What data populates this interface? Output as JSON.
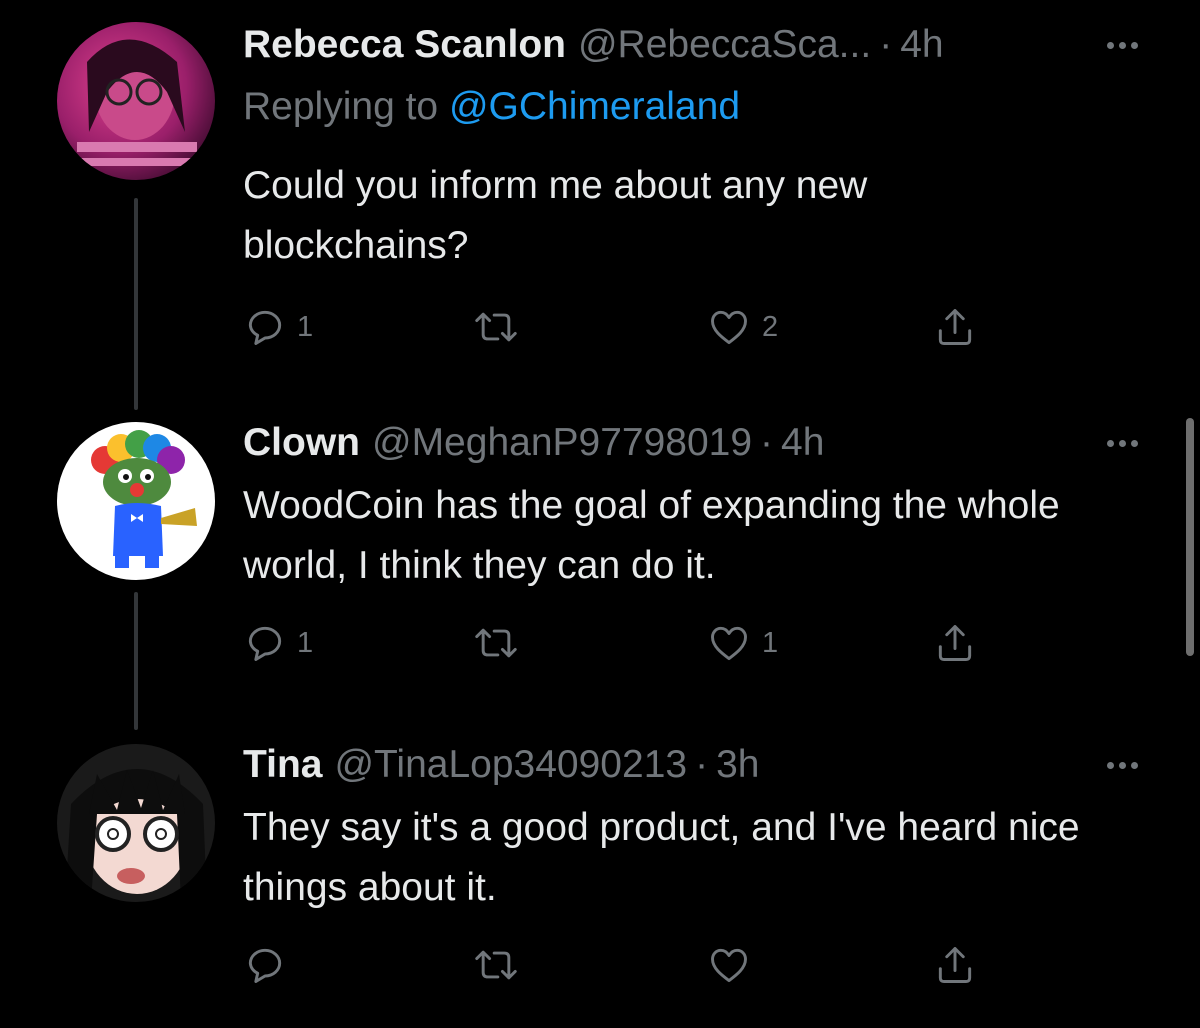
{
  "colors": {
    "background": "#000000",
    "text": "#e7e9ea",
    "muted": "#71767b",
    "link": "#1d9bf0",
    "thread_line": "#333639"
  },
  "tweets": [
    {
      "name": "Rebecca Scanlon",
      "handle": "@RebeccaSca...",
      "separator": "·",
      "time": "4h",
      "replying_prefix": "Replying to",
      "replying_to": "@GChimeraland",
      "text": "Could you inform me about any new blockchains?",
      "replies": "1",
      "retweets": "",
      "likes": "2"
    },
    {
      "name": "Clown",
      "handle": "@MeghanP97798019",
      "separator": "·",
      "time": "4h",
      "text": "WoodCoin has the goal of expanding the whole world, I think they can do it.",
      "replies": "1",
      "retweets": "",
      "likes": "1"
    },
    {
      "name": "Tina",
      "handle": "@TinaLop34090213",
      "separator": "·",
      "time": "3h",
      "text": "They say it's a good product, and I've heard nice things about it.",
      "replies": "",
      "retweets": "",
      "likes": ""
    }
  ],
  "icons": {
    "reply": "reply-icon",
    "retweet": "retweet-icon",
    "like": "heart-icon",
    "share": "share-icon",
    "more": "more-icon"
  }
}
